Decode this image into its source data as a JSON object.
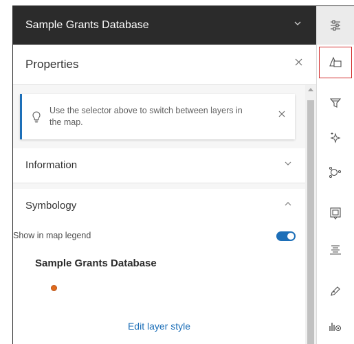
{
  "layer_selector": {
    "title": "Sample Grants Database",
    "chevron": "chevron-down-icon"
  },
  "properties": {
    "title": "Properties",
    "close": "close-icon"
  },
  "notice": {
    "text": "Use the selector above to switch between layers in the map.",
    "icon": "lightbulb-icon",
    "close": "close-icon"
  },
  "sections": {
    "information": {
      "title": "Information",
      "expanded": false
    },
    "symbology": {
      "title": "Symbology",
      "expanded": true,
      "legend_label": "Show in map legend",
      "legend_on": true,
      "layer_name": "Sample Grants Database",
      "edit_link": "Edit layer style"
    }
  },
  "rail": {
    "items": [
      "properties-toggle-icon",
      "styles-icon",
      "filter-icon",
      "effects-icon",
      "clustering-icon",
      "pop-ups-icon",
      "labels-icon",
      "sketch-icon",
      "fields-icon"
    ],
    "selected": "styles-icon"
  },
  "colors": {
    "accent": "#1d6fb8",
    "header_bg": "#2b2b2b",
    "point_symbol": "#e06a1b",
    "selection_outline": "#d22a2a"
  }
}
